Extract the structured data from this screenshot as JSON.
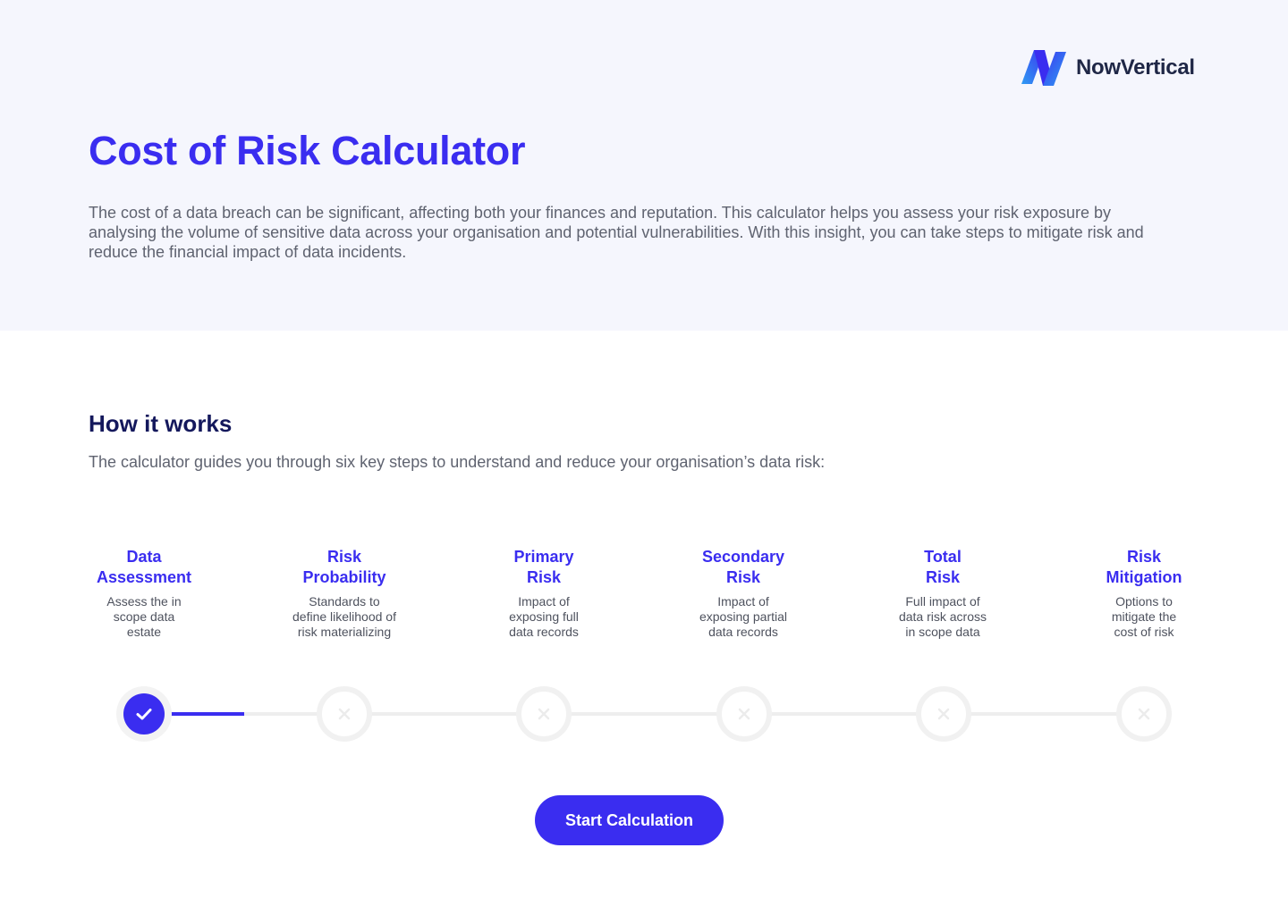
{
  "brand": {
    "name": "NowVertical",
    "logo_icon": "nowvertical-n-logo-icon",
    "colors": {
      "accent": "#3a2df0",
      "navy": "#14185c",
      "logo_blue": "#2f9bf3",
      "logo_indigo": "#3b38f0"
    }
  },
  "hero": {
    "title": "Cost of Risk Calculator",
    "intro": "The cost of a data breach can be significant, affecting both your finances and reputation. This calculator helps you assess your risk exposure by analysing the volume of sensitive data across your organisation and potential vulnerabilities. With this insight, you can take steps to mitigate risk and reduce the financial impact of data incidents."
  },
  "how_it_works": {
    "title": "How it works",
    "subtitle": "The calculator guides you through six key steps to understand and reduce your organisation’s data risk:"
  },
  "steps": [
    {
      "title": "Data\nAssessment",
      "description": "Assess the in\nscope data\nestate",
      "status": "complete",
      "icon": "check-icon"
    },
    {
      "title": "Risk\nProbability",
      "description": "Standards to\ndefine likelihood of\nrisk materializing",
      "status": "incomplete",
      "icon": "x-icon"
    },
    {
      "title": "Primary\nRisk",
      "description": "Impact of\nexposing full\ndata records",
      "status": "incomplete",
      "icon": "x-icon"
    },
    {
      "title": "Secondary\nRisk",
      "description": "Impact of\nexposing partial\ndata records",
      "status": "incomplete",
      "icon": "x-icon"
    },
    {
      "title": "Total\nRisk",
      "description": "Full impact of\ndata risk across\nin scope data",
      "status": "incomplete",
      "icon": "x-icon"
    },
    {
      "title": "Risk\nMitigation",
      "description": "Options to\nmitigate the\ncost of risk",
      "status": "incomplete",
      "icon": "x-icon"
    }
  ],
  "progress": {
    "completed_steps": 1,
    "total_steps": 6
  },
  "cta": {
    "label": "Start Calculation"
  }
}
